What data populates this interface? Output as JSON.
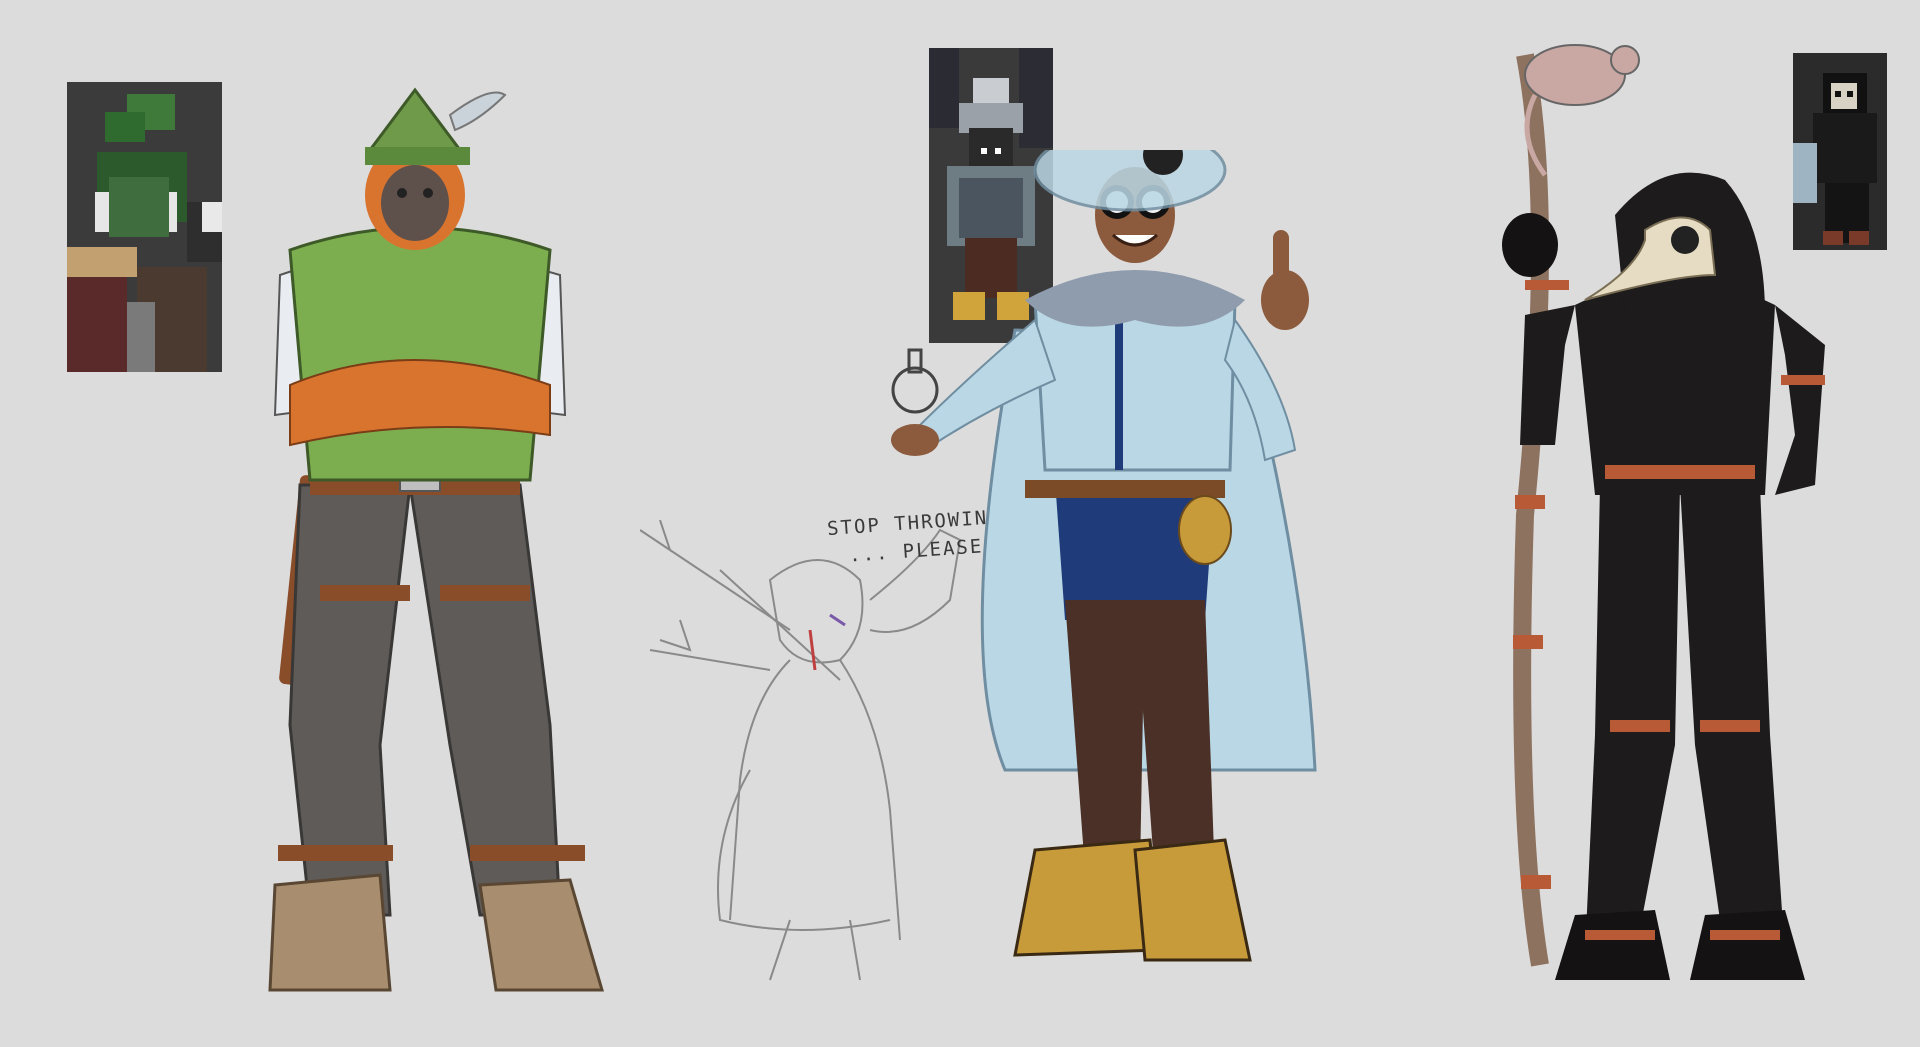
{
  "sheet": {
    "background": "#dcdcdc",
    "note": {
      "line1": "STOP THROWING",
      "line2": "... PLEASE"
    }
  },
  "references": [
    {
      "name": "ranger-voxel-reference"
    },
    {
      "name": "alchemist-voxel-reference"
    },
    {
      "name": "plague-doctor-voxel-reference"
    }
  ],
  "characters": [
    {
      "name": "orangutan-ranger",
      "colors": {
        "hat": "#6f9a4a",
        "shirt": "#7cae4f",
        "sleeve": "#e9edf2",
        "fur": "#d9742f",
        "pants": "#5e5b58",
        "boots": "#a88e6e",
        "strap": "#8a4d2a"
      }
    },
    {
      "name": "arrow-struck-sketch",
      "colors": {
        "line": "#8a8a8a"
      }
    },
    {
      "name": "goggled-alchemist",
      "colors": {
        "coat": "#b9d7e4",
        "fur": "#8f9cad",
        "pants": "#1f3b7a",
        "boots": "#4a3027",
        "shoes": "#c79a3a",
        "skin": "#8c5a3c",
        "belt": "#7b4a26"
      }
    },
    {
      "name": "plague-doctor",
      "colors": {
        "suit": "#1d1b1b",
        "mask": "#e6dcc4",
        "stripes": "#b85a36",
        "staff": "#8e7260",
        "rat": "#c9a8a4"
      }
    }
  ]
}
